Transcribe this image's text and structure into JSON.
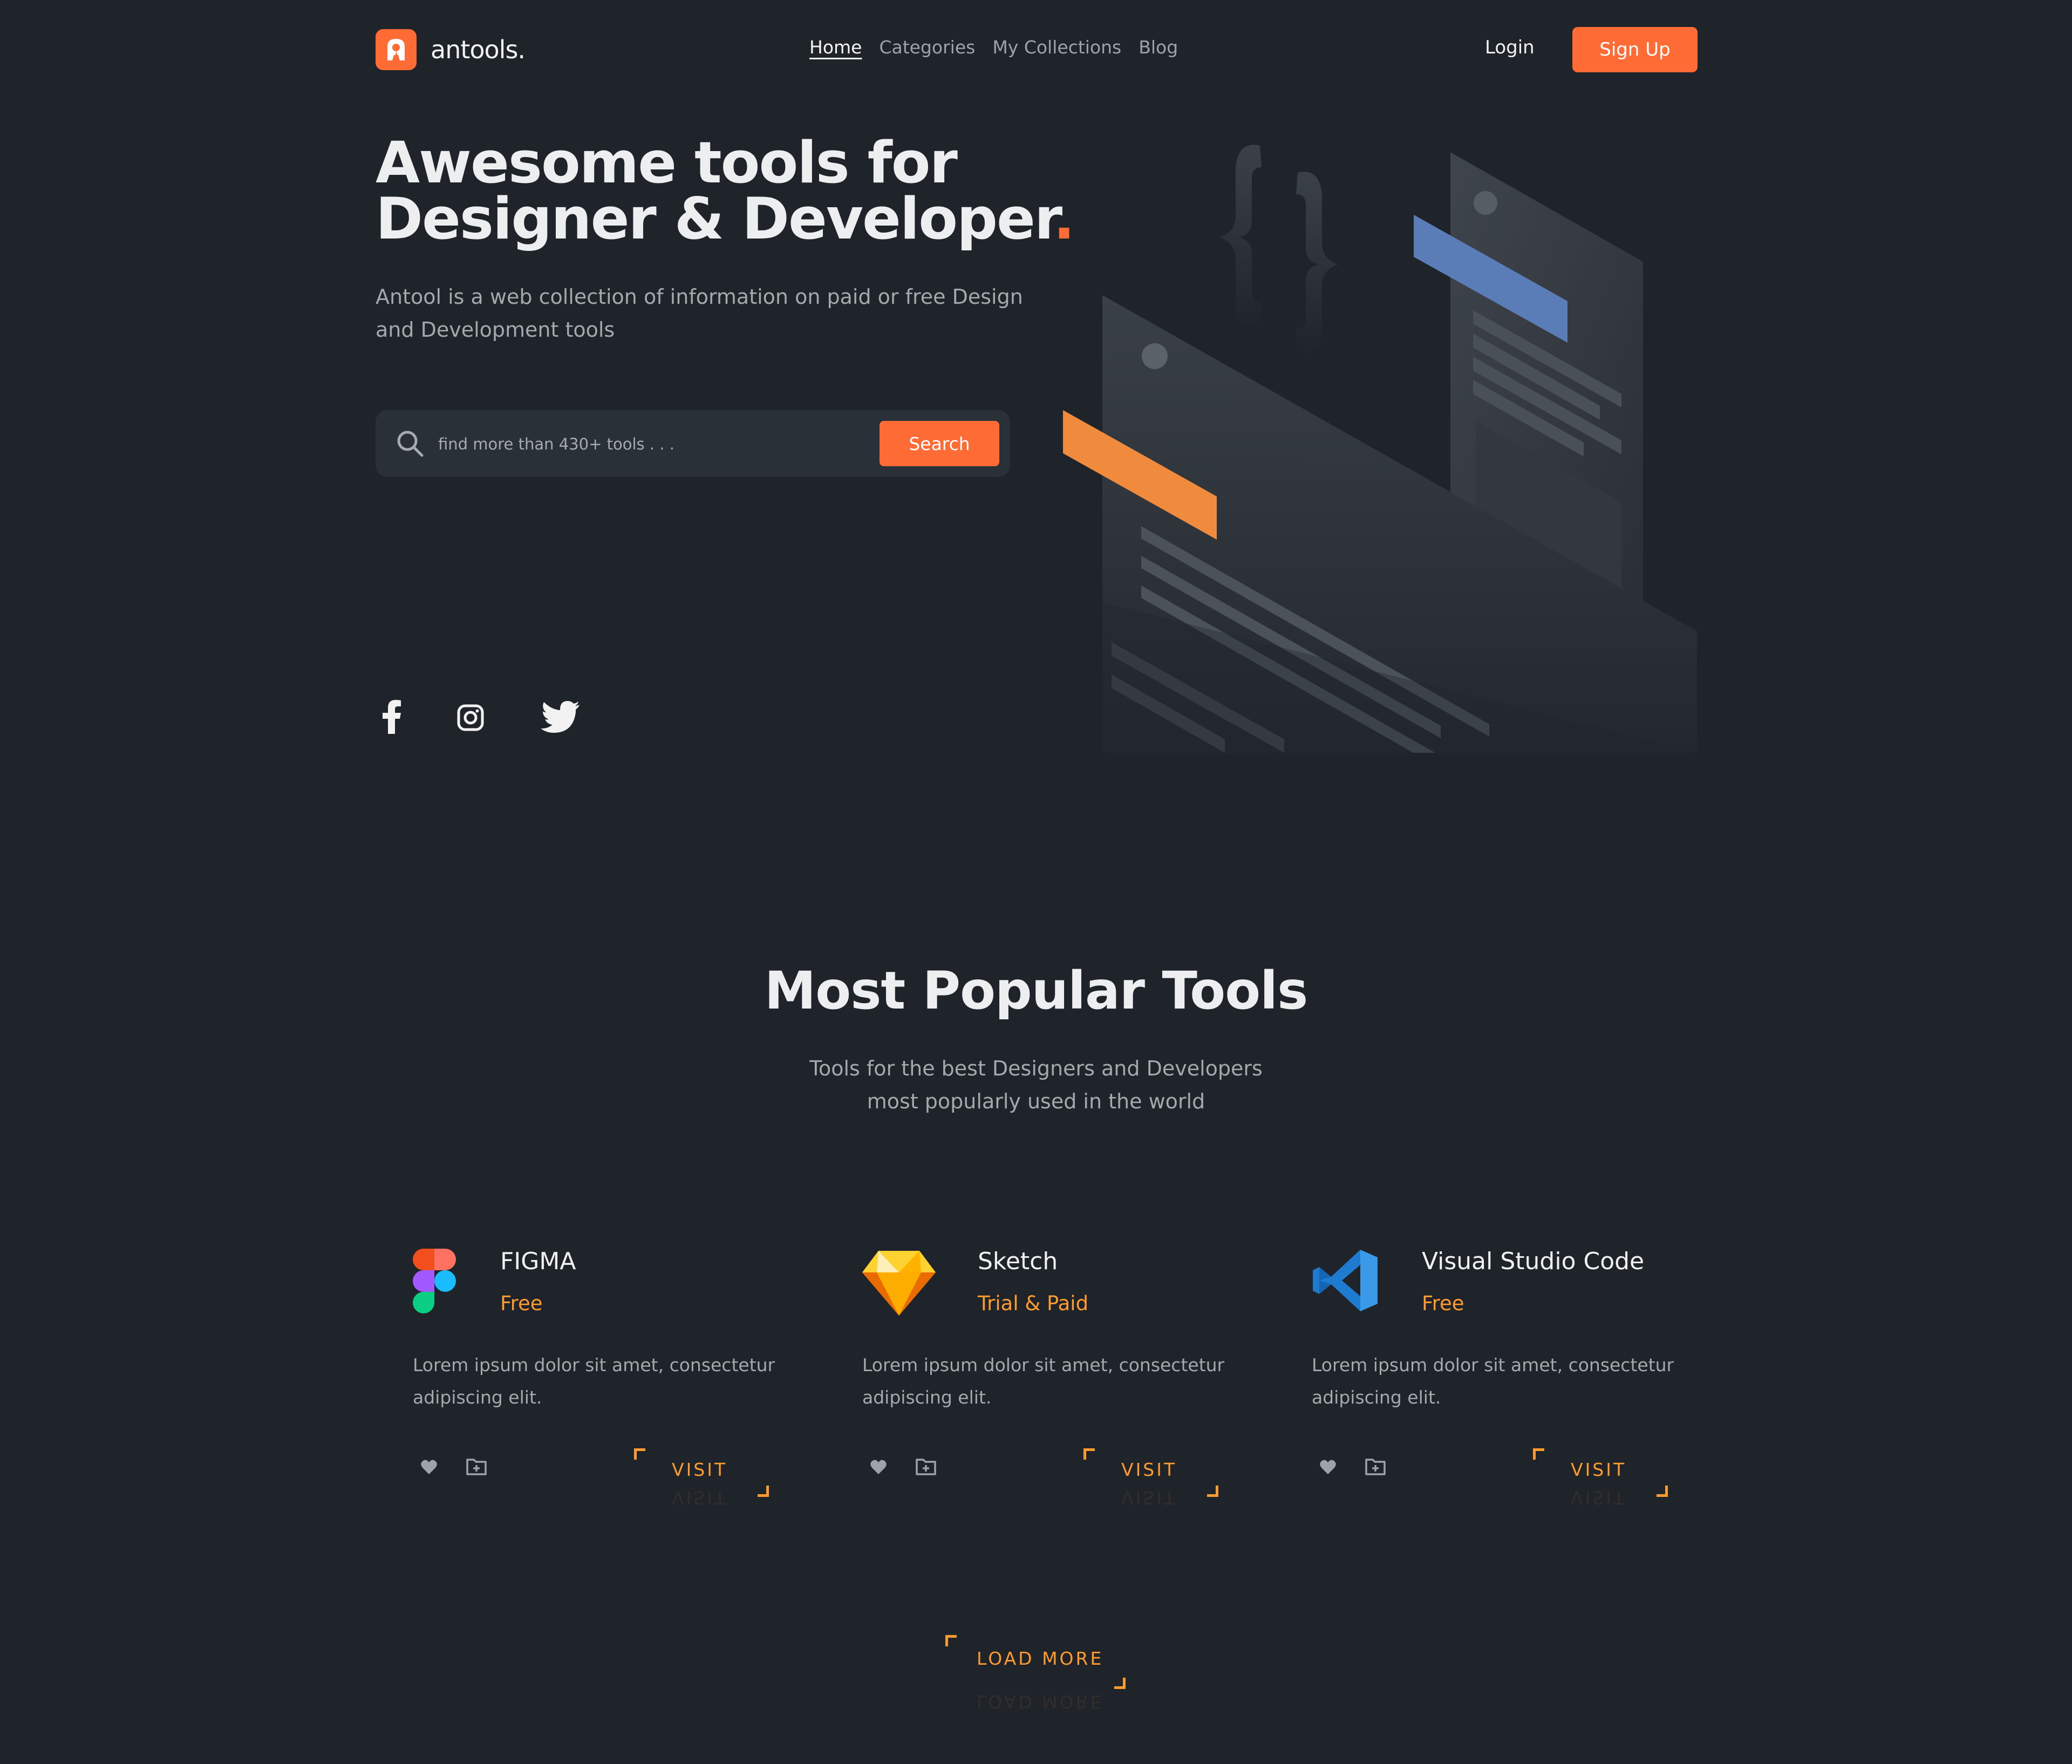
{
  "brand": {
    "name": "antools.",
    "accent": "#ff6b35"
  },
  "nav": {
    "items": [
      "Home",
      "Categories",
      "My Collections",
      "Blog"
    ],
    "active": "Home"
  },
  "auth": {
    "login": "Login",
    "signup": "Sign Up"
  },
  "hero": {
    "title_line1": "Awesome tools for",
    "title_line2": "Designer & Developer",
    "title_dot": ".",
    "subtitle": "Antool is a web collection of information on paid or free Design and Development tools",
    "search_placeholder": "find more than 430+ tools . . .",
    "search_button": "Search"
  },
  "social": [
    "facebook-icon",
    "instagram-icon",
    "twitter-icon"
  ],
  "popular": {
    "title": "Most Popular Tools",
    "subtitle_line1": "Tools for the best Designers and Developers",
    "subtitle_line2": "most popularly used in the world",
    "tools": [
      {
        "name": "FIGMA",
        "price": "Free",
        "icon": "figma-logo-icon",
        "description": "Lorem ipsum dolor sit amet, consectetur adipiscing elit.",
        "action": "VISIT"
      },
      {
        "name": "Sketch",
        "price": "Trial & Paid",
        "icon": "sketch-logo-icon",
        "description": "Lorem ipsum dolor sit amet, consectetur adipiscing elit.",
        "action": "VISIT"
      },
      {
        "name": "Visual Studio Code",
        "price": "Free",
        "icon": "vscode-logo-icon",
        "description": "Lorem ipsum dolor sit amet, consectetur adipiscing elit.",
        "action": "VISIT"
      }
    ],
    "load_more": "LOAD MORE"
  },
  "colors": {
    "background": "#1f242a",
    "accent": "#ff6b35",
    "price": "#ff9b2f",
    "muted": "#a4a9ae"
  }
}
